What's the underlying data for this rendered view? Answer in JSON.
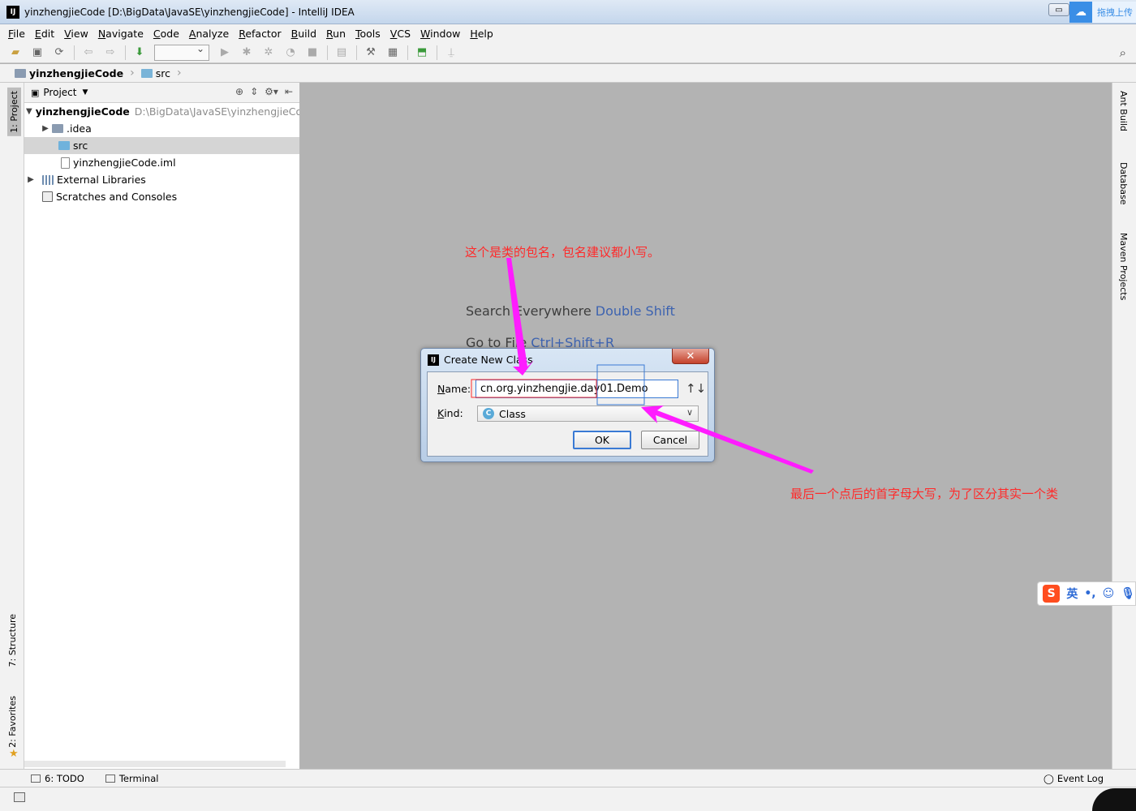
{
  "window": {
    "title": "yinzhengjieCode [D:\\BigData\\JavaSE\\yinzhengjieCode] - IntelliJ IDEA",
    "app_badge": "IJ",
    "upload_label": "拖拽上传"
  },
  "menu": {
    "items": [
      "File",
      "Edit",
      "View",
      "Navigate",
      "Code",
      "Analyze",
      "Refactor",
      "Build",
      "Run",
      "Tools",
      "VCS",
      "Window",
      "Help"
    ]
  },
  "breadcrumb": {
    "project": "yinzhengjieCode",
    "folder": "src"
  },
  "left_tabs": {
    "project": "1: Project",
    "structure": "7: Structure",
    "favorites": "2: Favorites"
  },
  "right_tabs": {
    "ant": "Ant Build",
    "database": "Database",
    "maven": "Maven Projects"
  },
  "project_panel": {
    "title": "Project",
    "tree": {
      "root_name": "yinzhengjieCode",
      "root_path": "D:\\BigData\\JavaSE\\yinzhengjieCode",
      "idea": ".idea",
      "src": "src",
      "iml": "yinzhengjieCode.iml",
      "libs": "External Libraries",
      "scratches": "Scratches and Consoles"
    }
  },
  "editor": {
    "hint1_text": "Search Everywhere",
    "hint1_key": "Double Shift",
    "hint2_text": "Go to File",
    "hint2_key": "Ctrl+Shift+R"
  },
  "dialog": {
    "title": "Create New Class",
    "name_label": "Name:",
    "name_value": "cn.org.yinzhengjie.day01.Demo",
    "kind_label": "Kind:",
    "kind_value": "Class",
    "ok": "OK",
    "cancel": "Cancel"
  },
  "bottom_tools": {
    "todo": "6: TODO",
    "terminal": "Terminal",
    "event_log": "Event Log"
  },
  "annotations": {
    "package_note": "这个是类的包名，包名建议都小写。",
    "class_note": "最后一个点后的首字母大写，为了区分其实一个类",
    "color": "#ff2a2a",
    "arrow_color": "#ff1cff"
  },
  "ime": {
    "lang": "英",
    "punct": "•,"
  },
  "colors": {
    "accent": "#3a7ad4",
    "shortcut": "#3d63b0"
  }
}
